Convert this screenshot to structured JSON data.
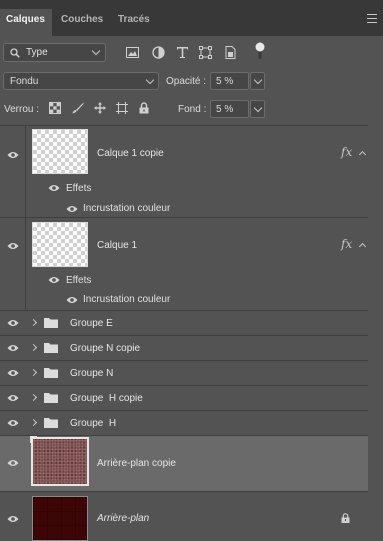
{
  "tabs": [
    {
      "label": "Calques",
      "active": true
    },
    {
      "label": "Couches",
      "active": false
    },
    {
      "label": "Tracés",
      "active": false
    }
  ],
  "filter": {
    "kind_label": "Type",
    "icons": [
      "image-filter-icon",
      "adjustment-filter-icon",
      "text-filter-icon",
      "shape-filter-icon",
      "smart-object-filter-icon"
    ]
  },
  "blend": {
    "mode": "Fondu",
    "opacity_label": "Opacité :",
    "opacity_value": "5 %"
  },
  "lock": {
    "label": "Verrou :",
    "fill_label": "Fond :",
    "fill_value": "5 %"
  },
  "layers": [
    {
      "name": "Calque 1 copie",
      "effects_label": "Effets",
      "effect": "Incrustation couleur"
    },
    {
      "name": "Calque 1",
      "effects_label": "Effets",
      "effect": "Incrustation couleur"
    },
    {
      "name": "Groupe E"
    },
    {
      "name": "Groupe N copie"
    },
    {
      "name": "Groupe N"
    },
    {
      "name": "Groupe  H copie"
    },
    {
      "name": "Groupe  H"
    },
    {
      "name": "Arrière-plan copie"
    },
    {
      "name": "Arrière-plan"
    }
  ],
  "colors": {
    "panel": "#535353",
    "selected": "#6a6a6a",
    "accent_dark_red": "#3d0505",
    "noise_red": "#7a5050"
  }
}
